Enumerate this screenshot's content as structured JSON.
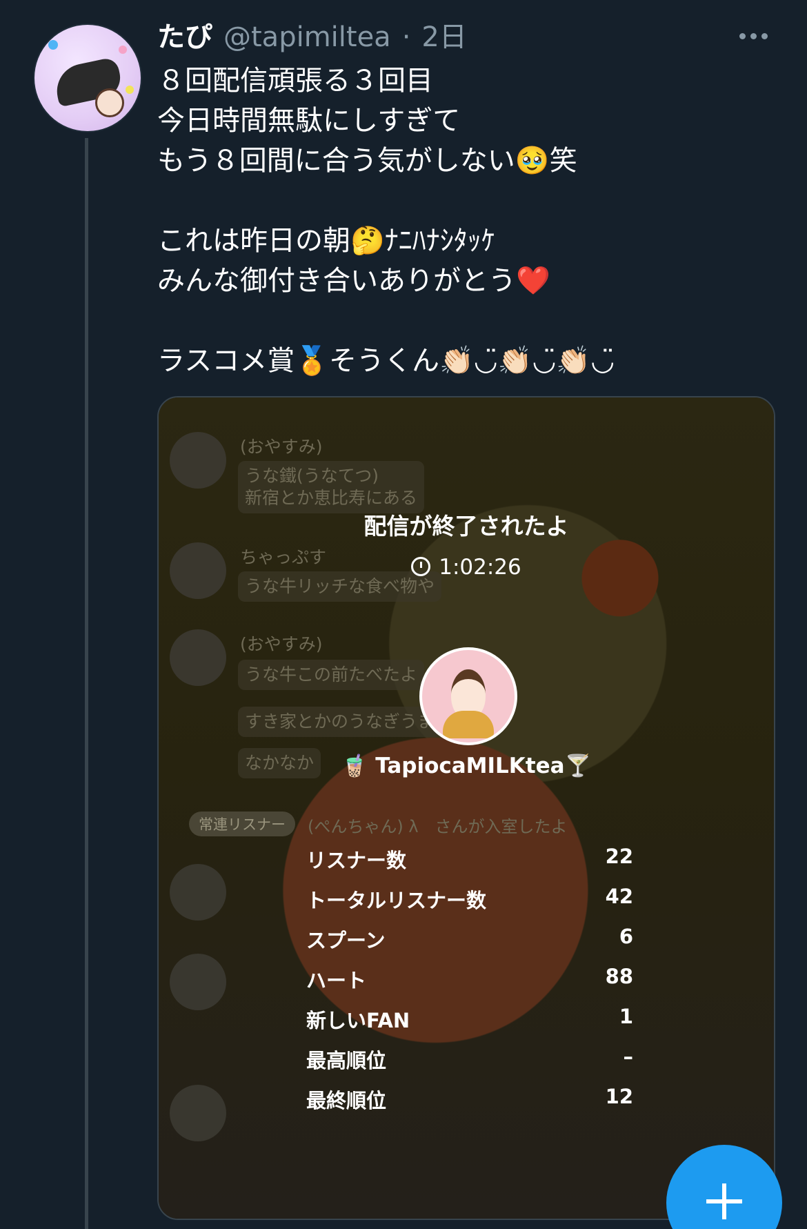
{
  "tweet": {
    "author_name": "たぴ",
    "handle": "@tapimiltea",
    "separator": "·",
    "time": "2日",
    "lines": [
      "８回配信頑張る３回目",
      "今日時間無駄にしすぎて",
      "もう８回間に合う気がしない🥹笑",
      "",
      "これは昨日の朝🤔ﾅﾆﾊﾅｼﾀｯｹ",
      "みんな御付き合いありがとう❤️",
      "",
      "ラスコメ賞🏅そうくん👏🏻◡̈👏🏻◡̈👏🏻◡̈"
    ]
  },
  "card": {
    "end_title": "配信が終了されたよ",
    "duration": "1:02:26",
    "host_name": "🧋 TapiocaMILKtea🍸",
    "regular_badge": "常連リスナー",
    "join_message": "(ぺんちゃん) λ　さんが入室したよ",
    "background_comments": [
      {
        "name": "(おやすみ)",
        "bubbles": [
          "うな鐵(うなてつ)",
          "新宿とか恵比寿にある"
        ]
      },
      {
        "name": "ちゃっぷす",
        "bubbles": [
          "うな牛リッチな食べ物や"
        ]
      },
      {
        "name": "(おやすみ)",
        "bubbles": [
          "うな牛この前たべたよ",
          "すき家とかのうなぎうま",
          "なかなか"
        ]
      }
    ],
    "stats": [
      {
        "label": "リスナー数",
        "value": "22"
      },
      {
        "label": "トータルリスナー数",
        "value": "42"
      },
      {
        "label": "スプーン",
        "value": "6"
      },
      {
        "label": "ハート",
        "value": "88"
      },
      {
        "label": "新しいFAN",
        "value": "1"
      },
      {
        "label": "最高順位",
        "value": "–"
      },
      {
        "label": "最終順位",
        "value": "12"
      }
    ]
  },
  "icons": {
    "more": "more-horizontal-icon",
    "clock": "clock-icon",
    "compose": "plus-icon"
  },
  "colors": {
    "background": "#15202b",
    "secondary_text": "#8899a6",
    "accent": "#1d9bf0"
  }
}
